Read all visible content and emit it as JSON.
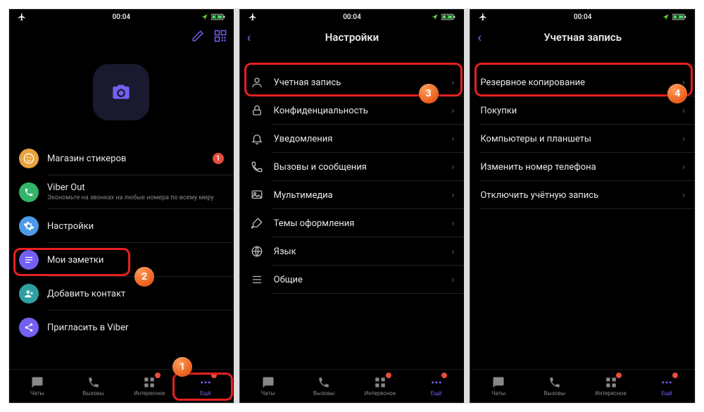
{
  "status": {
    "airplane": "✈",
    "wifi": "⎋",
    "time": "00:04",
    "location_arrow": "➤",
    "battery": "83"
  },
  "screen1": {
    "edit_icon": "pencil-icon",
    "qr_icon": "qr-icon",
    "avatar_icon": "camera-icon",
    "items": [
      {
        "label": "Магазин стикеров",
        "badge": "1"
      },
      {
        "label": "Viber Out",
        "sub": "Экономьте на звонках на любые номера по всему миру"
      },
      {
        "label": "Настройки"
      },
      {
        "label": "Мои заметки"
      },
      {
        "label": "Добавить контакт"
      },
      {
        "label": "Пригласить в Viber"
      }
    ]
  },
  "screen2": {
    "title": "Настройки",
    "rows": [
      {
        "label": "Учетная запись"
      },
      {
        "label": "Конфиденциальность"
      },
      {
        "label": "Уведомления"
      },
      {
        "label": "Вызовы и сообщения"
      },
      {
        "label": "Мультимедиа"
      },
      {
        "label": "Темы оформления"
      },
      {
        "label": "Язык"
      },
      {
        "label": "Общие"
      }
    ]
  },
  "screen3": {
    "title": "Учетная запись",
    "rows": [
      {
        "label": "Резервное копирование"
      },
      {
        "label": "Покупки"
      },
      {
        "label": "Компьютеры и планшеты"
      },
      {
        "label": "Изменить номер телефона"
      },
      {
        "label": "Отключить учётную запись"
      }
    ]
  },
  "tabs": [
    {
      "label": "Чаты"
    },
    {
      "label": "Вызовы"
    },
    {
      "label": "Интересное"
    },
    {
      "label": "Ещё"
    }
  ],
  "callouts": {
    "c1": "1",
    "c2": "2",
    "c3": "3",
    "c4": "4"
  }
}
